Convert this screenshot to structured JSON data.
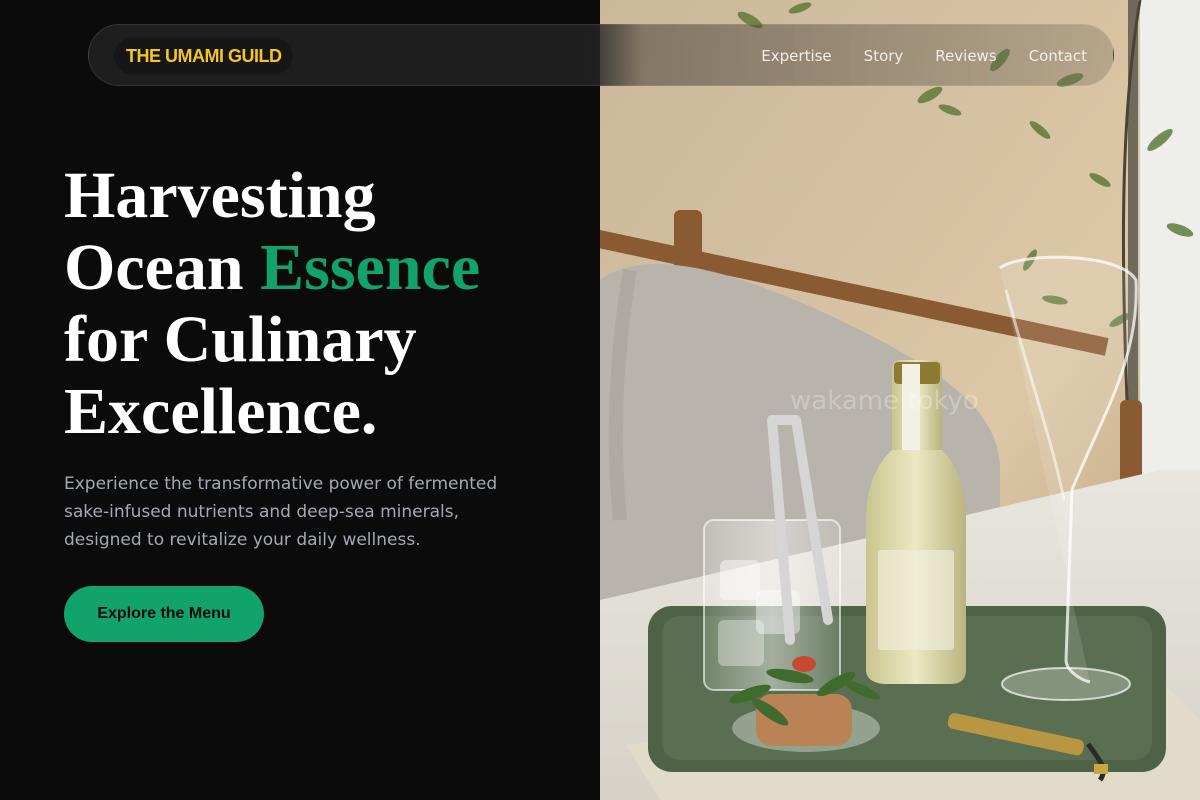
{
  "nav": {
    "brand": "THE UMAMI GUILD",
    "links": [
      "Expertise",
      "Story",
      "Reviews",
      "Contact"
    ]
  },
  "hero": {
    "title_line1": "Harvesting",
    "title_line2_a": "Ocean ",
    "title_line2_accent": "Essence",
    "title_line3": "for Culinary",
    "title_line4": "Excellence.",
    "description": "Experience the transformative power of fermented sake-infused nutrients and deep-sea minerals, designed to revitalize your daily wellness.",
    "cta_label": "Explore the Menu"
  },
  "photo": {
    "watermark": "wakame tokyo"
  },
  "colors": {
    "accent_green": "#12a36c",
    "brand_yellow": "#f3c623",
    "background": "#0b0b0b",
    "muted_text": "#a4a9b3"
  }
}
